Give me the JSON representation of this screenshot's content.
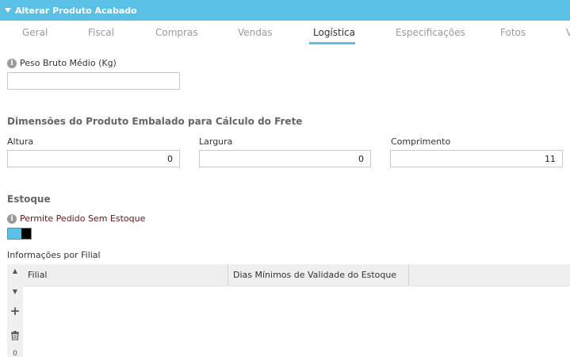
{
  "window": {
    "title": "Alterar Produto Acabado"
  },
  "tabs": [
    {
      "label": "Geral",
      "active": false
    },
    {
      "label": "Fiscal",
      "active": false
    },
    {
      "label": "Compras",
      "active": false
    },
    {
      "label": "Vendas",
      "active": false
    },
    {
      "label": "Logística",
      "active": true
    },
    {
      "label": "Especificações",
      "active": false
    },
    {
      "label": "Fotos",
      "active": false
    },
    {
      "label": "V",
      "active": false
    }
  ],
  "peso": {
    "label": "Peso Bruto Médio (Kg)",
    "value": ""
  },
  "dimensoes": {
    "title": "Dimensões do Produto Embalado para Cálculo do Frete",
    "altura": {
      "label": "Altura",
      "value": "0"
    },
    "largura": {
      "label": "Largura",
      "value": "0"
    },
    "comprimento": {
      "label": "Comprimento",
      "value": "11"
    }
  },
  "estoque": {
    "title": "Estoque",
    "permite_label": "Permite Pedido Sem Estoque",
    "permite_on": true
  },
  "filial": {
    "title": "Informações por Filial",
    "columns": [
      "Filial",
      "Dias Mínimos de Validade do Estoque",
      ""
    ],
    "toolbar": [
      "move-up-icon",
      "move-down-icon",
      "add-icon",
      "trash-icon",
      "0"
    ]
  },
  "colors": {
    "accent": "#5bc0e6",
    "label_dark": "#6b1414"
  }
}
